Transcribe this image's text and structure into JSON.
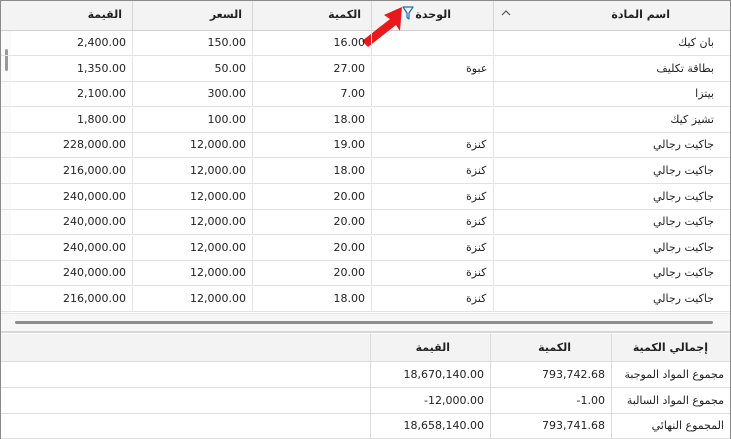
{
  "grid": {
    "columns": {
      "value": "القيمة",
      "price": "السعر",
      "quantity": "الكمية",
      "unit": "الوحدة",
      "item_name": "اسم المادة"
    },
    "rows": [
      {
        "value": "2,400.00",
        "price": "150.00",
        "quantity": "16.00",
        "unit": "",
        "name": "بان كيك"
      },
      {
        "value": "1,350.00",
        "price": "50.00",
        "quantity": "27.00",
        "unit": "عبوة",
        "name": "بطاقة تكليف"
      },
      {
        "value": "2,100.00",
        "price": "300.00",
        "quantity": "7.00",
        "unit": "",
        "name": "بيتزا"
      },
      {
        "value": "1,800.00",
        "price": "100.00",
        "quantity": "18.00",
        "unit": "",
        "name": "تشيز كيك"
      },
      {
        "value": "228,000.00",
        "price": "12,000.00",
        "quantity": "19.00",
        "unit": "كنزة",
        "name": "جاكيت رجالي"
      },
      {
        "value": "216,000.00",
        "price": "12,000.00",
        "quantity": "18.00",
        "unit": "كنزة",
        "name": "جاكيت رجالي"
      },
      {
        "value": "240,000.00",
        "price": "12,000.00",
        "quantity": "20.00",
        "unit": "كنزة",
        "name": "جاكيت رجالي"
      },
      {
        "value": "240,000.00",
        "price": "12,000.00",
        "quantity": "20.00",
        "unit": "كنزة",
        "name": "جاكيت رجالي"
      },
      {
        "value": "240,000.00",
        "price": "12,000.00",
        "quantity": "20.00",
        "unit": "كنزة",
        "name": "جاكيت رجالي"
      },
      {
        "value": "240,000.00",
        "price": "12,000.00",
        "quantity": "20.00",
        "unit": "كنزة",
        "name": "جاكيت رجالي"
      },
      {
        "value": "216,000.00",
        "price": "12,000.00",
        "quantity": "18.00",
        "unit": "كنزة",
        "name": "جاكيت رجالي"
      }
    ]
  },
  "summary": {
    "columns": {
      "value": "القيمة",
      "quantity": "الكمية",
      "total_quantity": "إجمالي الكمية"
    },
    "rows": [
      {
        "label": "مجموع المواد الموجبة",
        "quantity": "793,742.68",
        "value": "18,670,140.00"
      },
      {
        "label": "مجموع المواد السالبة",
        "quantity": "-1.00",
        "value": "-12,000.00"
      },
      {
        "label": "المجموع النهائي",
        "quantity": "793,741.68",
        "value": "18,658,140.00"
      }
    ]
  },
  "icons": {
    "sort": "chevron-up-icon",
    "filter": "filter-icon",
    "pointer": "red-arrow-annotation"
  },
  "colors": {
    "arrow": "#e8191c",
    "filter": "#1a6fb5"
  }
}
